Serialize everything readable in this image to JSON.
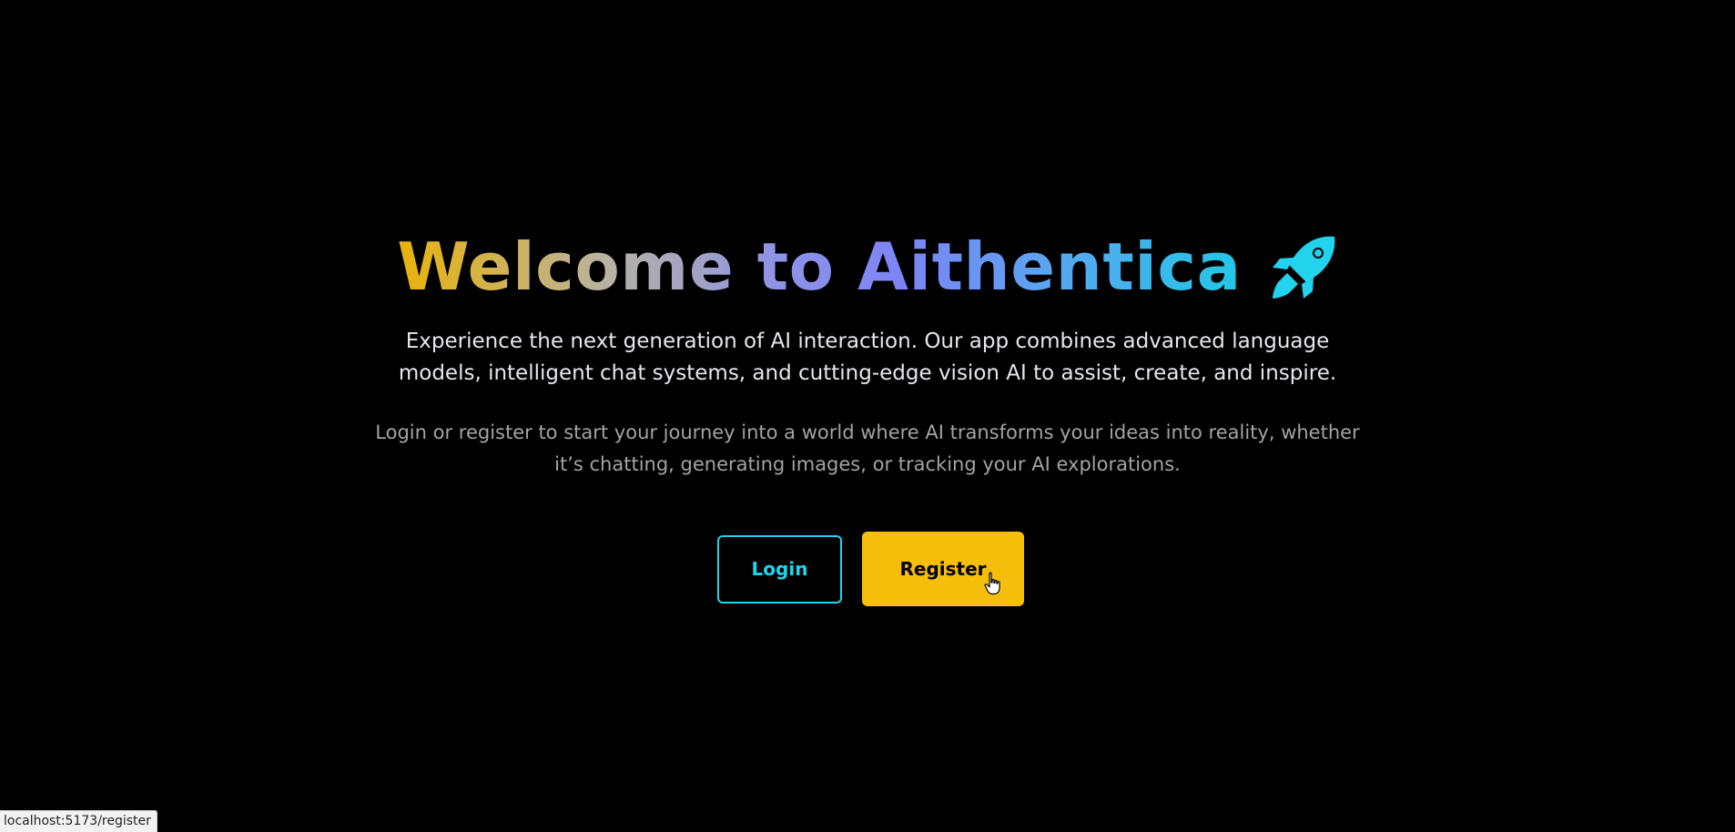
{
  "hero": {
    "title": "Welcome to Aithentica",
    "title_icon": "rocket-icon",
    "lead": "Experience the next generation of AI interaction. Our app combines advanced language models, intelligent chat systems, and cutting-edge vision AI to assist, create, and inspire.",
    "sub": "Login or register to start your journey into a world where AI transforms your ideas into reality, whether it’s chatting, generating images, or tracking your AI explorations."
  },
  "actions": {
    "login_label": "Login",
    "register_label": "Register"
  },
  "status_bar": {
    "hover_url": "localhost:5173/register"
  },
  "colors": {
    "background": "#000000",
    "accent_cyan": "#22d3ee",
    "accent_yellow": "#f5be0b",
    "title_gradient": [
      "#eab308",
      "#8e93e6",
      "#7c84f5",
      "#22c7e6"
    ]
  }
}
